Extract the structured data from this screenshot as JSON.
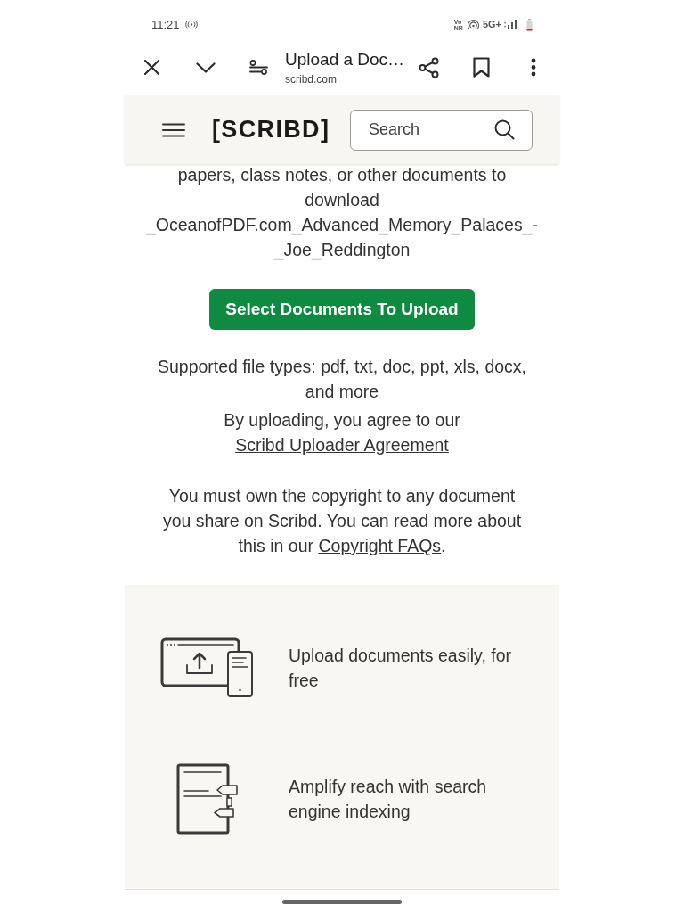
{
  "status_bar": {
    "time": "11:21",
    "network_badge": [
      "Vo",
      "NR"
    ],
    "network_type": "5G+"
  },
  "browser_toolbar": {
    "page_title": "Upload a Doc…",
    "domain": "scribd.com"
  },
  "site_header": {
    "logo": "[SCRIBD]",
    "search": {
      "placeholder": "Search"
    }
  },
  "upload_section": {
    "intro_text": "papers, class notes, or other documents to download _OceanofPDF.com_Advanced_Memory_Palaces_-_Joe_Reddington",
    "upload_button": "Select Documents To Upload",
    "supported_types": "Supported file types: pdf, txt, doc, ppt, xls, docx, and more",
    "agreement": {
      "text": "By uploading, you agree to our",
      "link": "Scribd Uploader Agreement"
    },
    "copyright": {
      "text": "You must own the copyright to any document you share on Scribd. You can read more about this in our",
      "link": "Copyright FAQs",
      "suffix": "."
    }
  },
  "features": [
    {
      "kind": "upload",
      "text": "Upload documents easily, for free"
    },
    {
      "kind": "indexing",
      "text": "Amplify reach with search engine indexing"
    }
  ]
}
